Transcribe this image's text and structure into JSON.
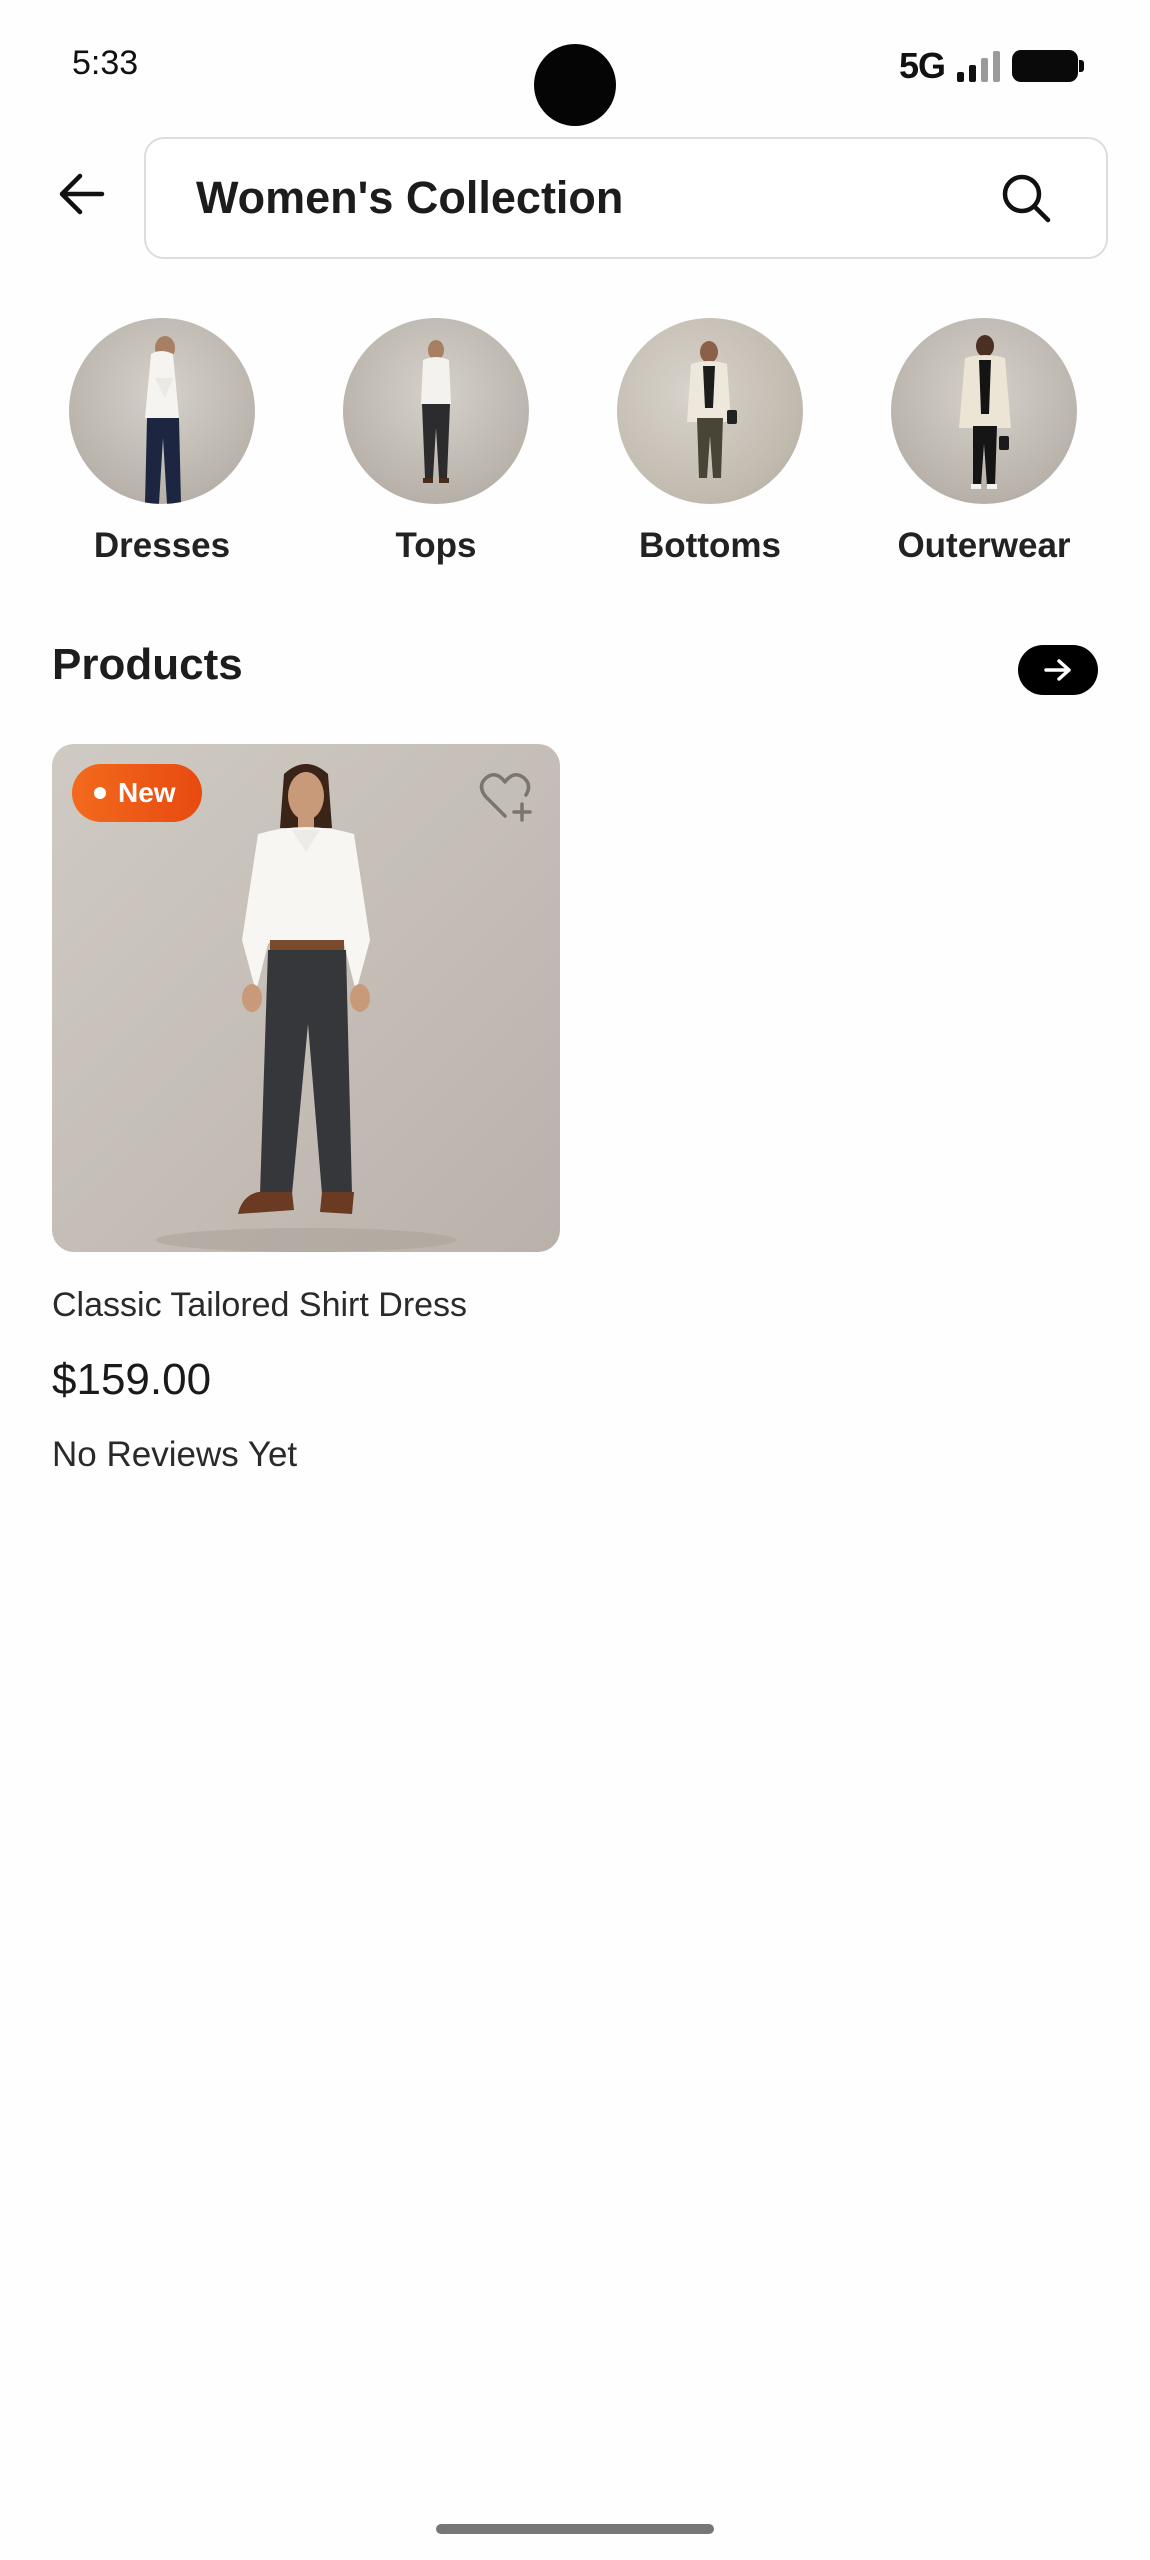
{
  "status_bar": {
    "time": "5:33",
    "network": "5G"
  },
  "header": {
    "search_value": "Women's Collection"
  },
  "categories": [
    {
      "label": "Dresses"
    },
    {
      "label": "Tops"
    },
    {
      "label": "Bottoms"
    },
    {
      "label": "Outerwear"
    }
  ],
  "products_section": {
    "title": "Products"
  },
  "products": [
    {
      "badge": "New",
      "name": "Classic Tailored Shirt Dress",
      "price": "$159.00",
      "reviews": "No Reviews Yet"
    }
  ],
  "colors": {
    "badge": "#ee5a16",
    "accent": "#000000"
  },
  "icons": [
    "arrow-left-icon",
    "search-icon",
    "arrow-right-icon",
    "heart-plus-icon"
  ]
}
